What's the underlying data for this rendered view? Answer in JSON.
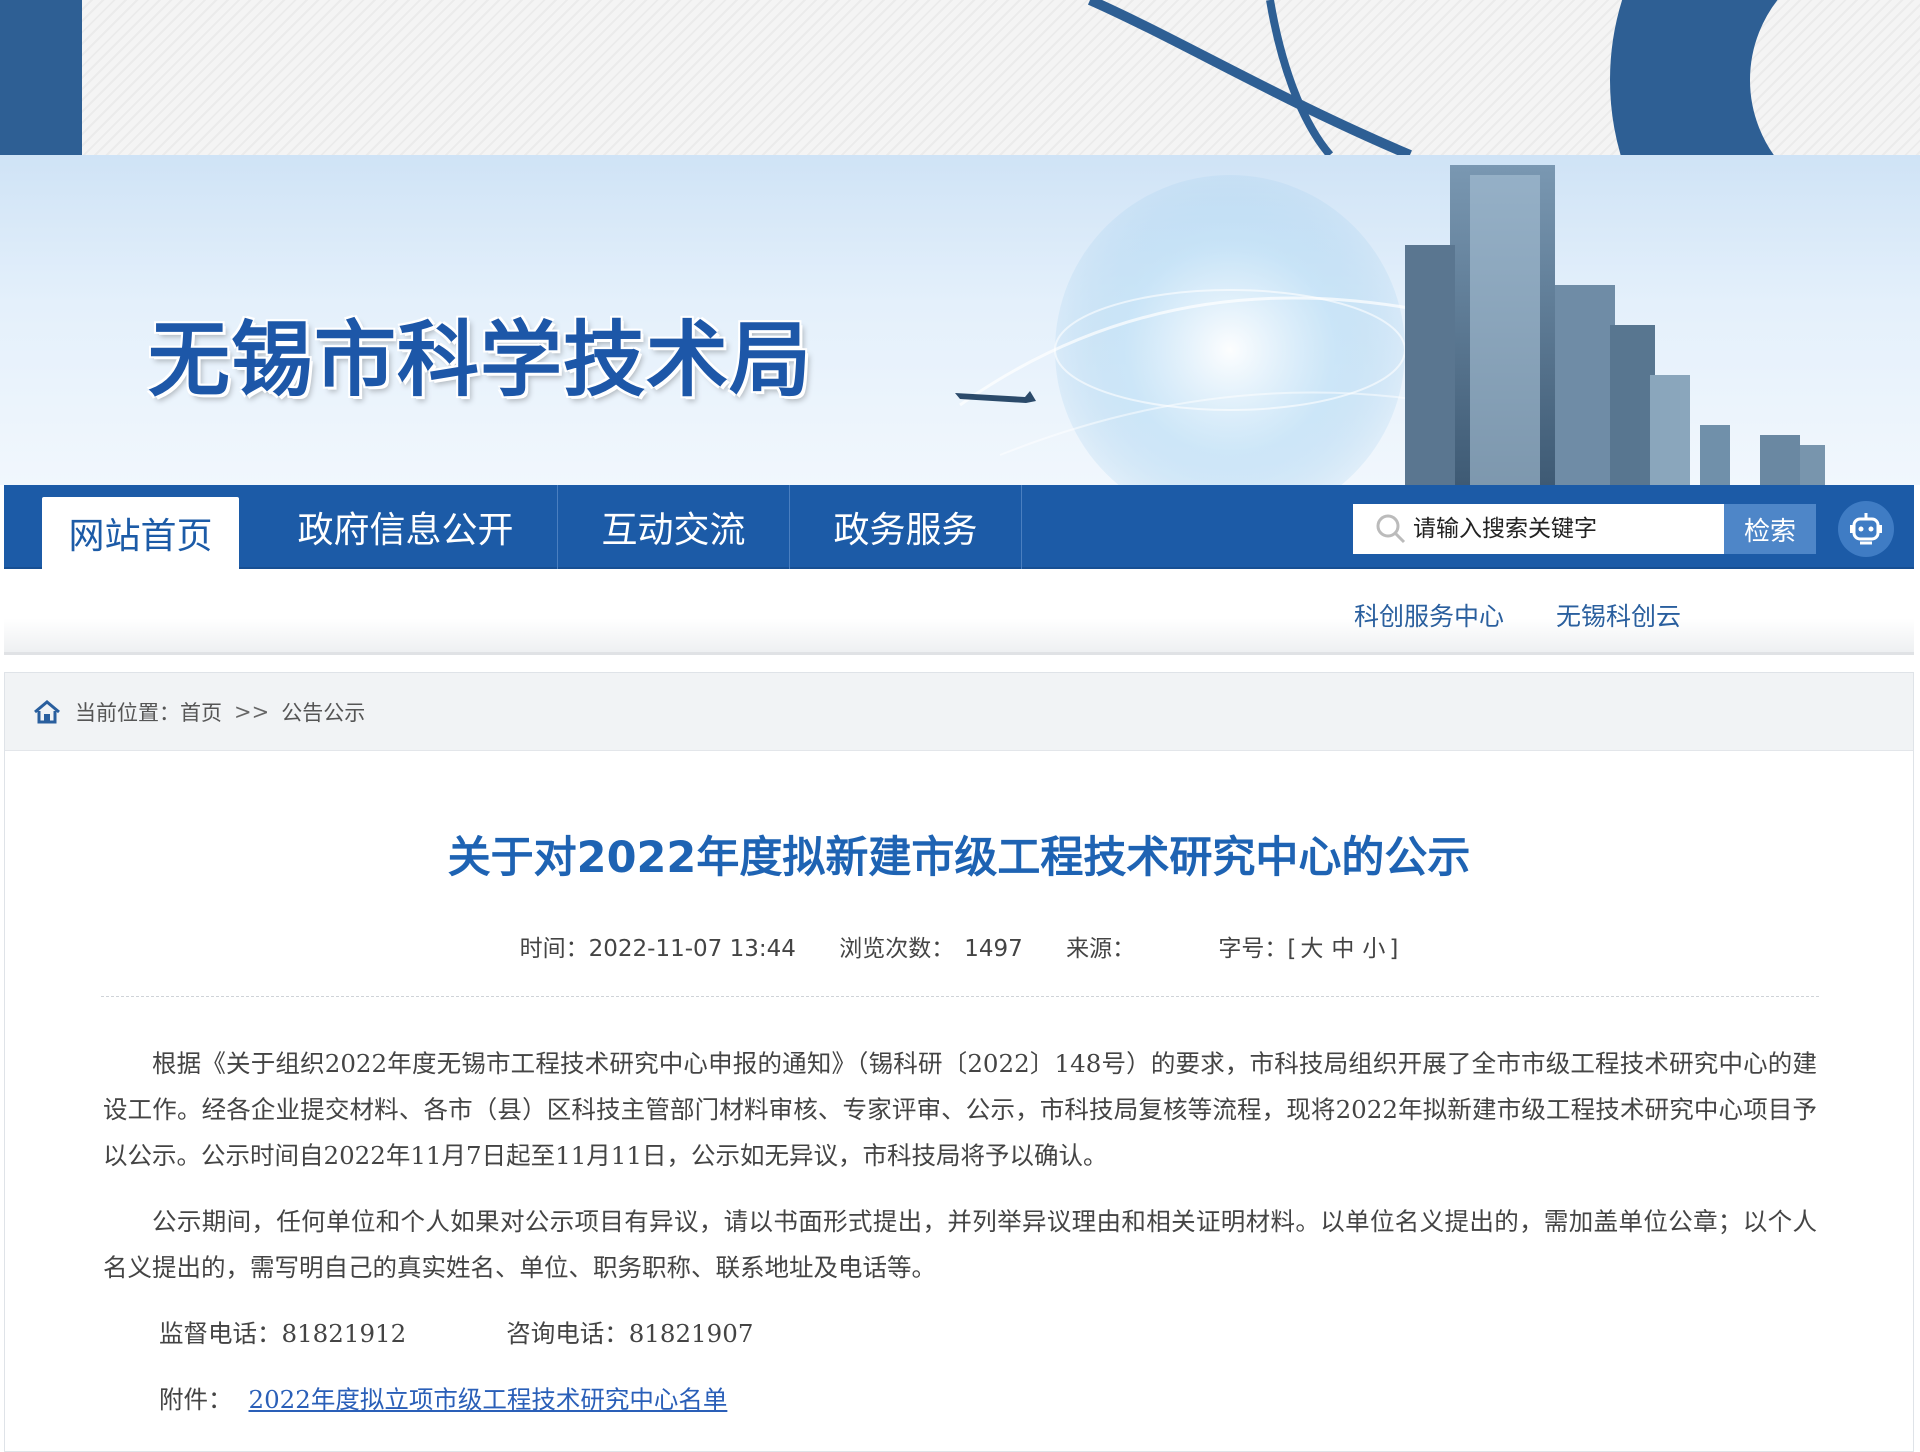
{
  "site": {
    "title": "无锡市科学技术局"
  },
  "nav": {
    "items": [
      {
        "label": "网站首页"
      },
      {
        "label": "政府信息公开"
      },
      {
        "label": "互动交流"
      },
      {
        "label": "政务服务"
      }
    ],
    "search": {
      "placeholder": "请输入搜索关键字",
      "button": "检索"
    }
  },
  "sublinks": [
    {
      "label": "科创服务中心"
    },
    {
      "label": "无锡科创云"
    }
  ],
  "breadcrumb": {
    "prefix": "当前位置：",
    "home": "首页",
    "separator": ">>",
    "current": "公告公示"
  },
  "article": {
    "title": "关于对2022年度拟新建市级工程技术研究中心的公示",
    "meta": {
      "time_label": "时间：",
      "time_value": "2022-11-07 13:44",
      "views_label": "浏览次数：",
      "views_value": "1497",
      "source_label": "来源：",
      "source_value": "",
      "font_label": "字号：",
      "font_open": "[",
      "font_large": "大",
      "font_medium": "中",
      "font_small": "小",
      "font_close": "]"
    },
    "paragraphs": [
      "根据《关于组织2022年度无锡市工程技术研究中心申报的通知》（锡科研〔2022〕148号）的要求，市科技局组织开展了全市市级工程技术研究中心的建设工作。经各企业提交材料、各市（县）区科技主管部门材料审核、专家评审、公示，市科技局复核等流程，现将2022年拟新建市级工程技术研究中心项目予以公示。公示时间自2022年11月7日起至11月11日，公示如无异议，市科技局将予以确认。",
      "公示期间，任何单位和个人如果对公示项目有异议，请以书面形式提出，并列举异议理由和相关证明材料。以单位名义提出的，需加盖单位公章；以个人名义提出的，需写明自己的真实姓名、单位、职务职称、联系地址及电话等。"
    ],
    "contacts": {
      "supervise": "监督电话：81821912",
      "consult": "咨询电话：81821907"
    },
    "attachment": {
      "label": "附件：",
      "link": "2022年度拟立项市级工程技术研究中心名单"
    }
  },
  "colors": {
    "primary": "#1c5ba7",
    "title_blue": "#1e63b3",
    "link": "#2a5fb8"
  },
  "icons": [
    "search-icon",
    "robot-icon",
    "home-icon"
  ]
}
